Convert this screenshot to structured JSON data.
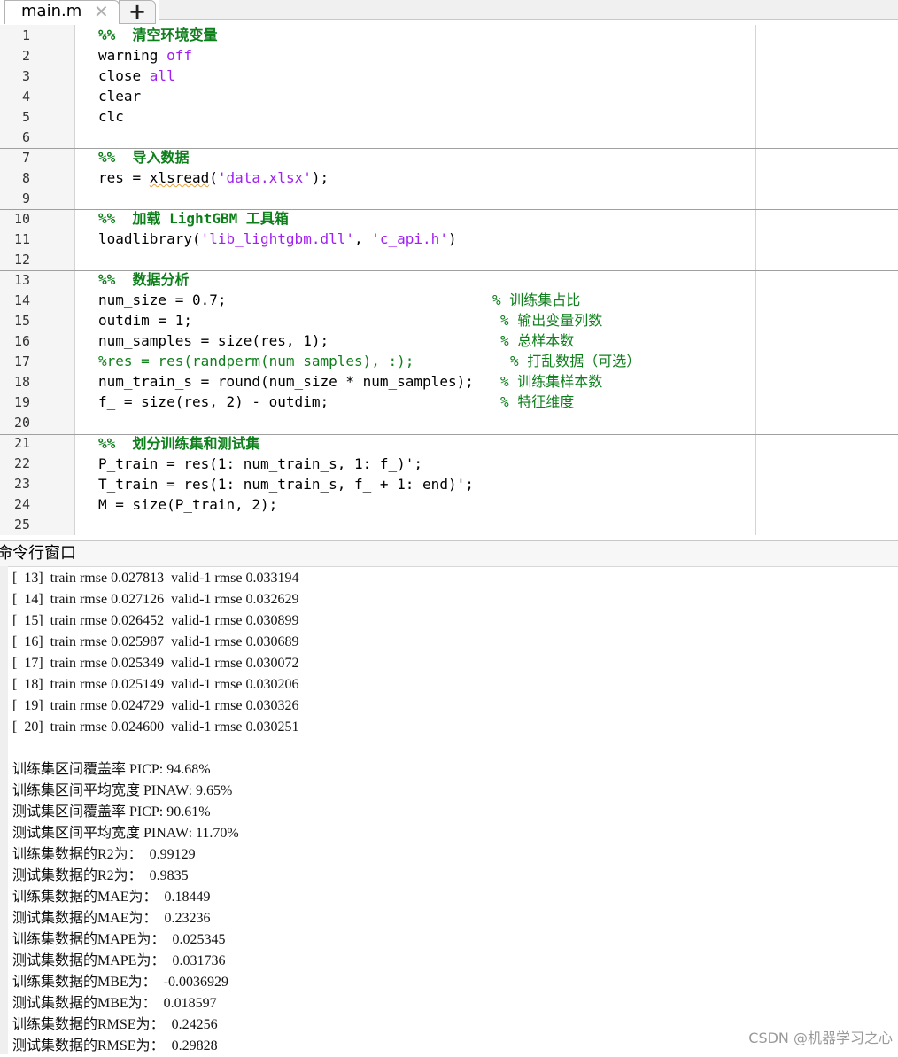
{
  "tab": {
    "filename": "main.m",
    "close_glyph": "✕",
    "add_glyph": "+"
  },
  "editor": {
    "lines": [
      {
        "n": "1"
      },
      {
        "n": "2"
      },
      {
        "n": "3"
      },
      {
        "n": "4"
      },
      {
        "n": "5"
      },
      {
        "n": "6"
      },
      {
        "n": "7"
      },
      {
        "n": "8"
      },
      {
        "n": "9"
      },
      {
        "n": "10"
      },
      {
        "n": "11"
      },
      {
        "n": "12"
      },
      {
        "n": "13"
      },
      {
        "n": "14"
      },
      {
        "n": "15"
      },
      {
        "n": "16"
      },
      {
        "n": "17"
      },
      {
        "n": "18"
      },
      {
        "n": "19"
      },
      {
        "n": "20"
      },
      {
        "n": "21"
      },
      {
        "n": "22"
      },
      {
        "n": "23"
      },
      {
        "n": "24"
      },
      {
        "n": "25"
      }
    ],
    "code": {
      "l1": "%%  清空环境变量",
      "l2a": "warning ",
      "l2b": "off",
      "l3a": "close ",
      "l3b": "all",
      "l4": "clear",
      "l5": "clc",
      "l7": "%%  导入数据",
      "l8a": "res = ",
      "l8b": "xlsread",
      "l8c": "(",
      "l8d": "'data.xlsx'",
      "l8e": ");",
      "l10": "%%  加载 LightGBM 工具箱",
      "l11a": "loadlibrary(",
      "l11b": "'lib_lightgbm.dll'",
      "l11c": ", ",
      "l11d": "'c_api.h'",
      "l11e": ")",
      "l13": "%%  数据分析",
      "l14": "num_size = 0.7;",
      "l14c": "% 训练集占比",
      "l15": "outdim = 1;",
      "l15c": "% 输出变量列数",
      "l16": "num_samples = size(res, 1);",
      "l16c": "% 总样本数",
      "l17": "%res = res(randperm(num_samples), :);",
      "l17c": "% 打乱数据（可选）",
      "l18": "num_train_s = round(num_size * num_samples);",
      "l18c": "% 训练集样本数",
      "l19": "f_ = size(res, 2) - outdim;",
      "l19c": "% 特征维度",
      "l21": "%%  划分训练集和测试集",
      "l22": "P_train = res(1: num_train_s, 1: f_)';",
      "l23": "T_train = res(1: num_train_s, f_ + 1: end)';",
      "l24": "M = size(P_train, 2);"
    }
  },
  "command_window": {
    "title": "命令行窗口",
    "iterations": [
      "[  13]  train rmse 0.027813  valid-1 rmse 0.033194",
      "[  14]  train rmse 0.027126  valid-1 rmse 0.032629",
      "[  15]  train rmse 0.026452  valid-1 rmse 0.030899",
      "[  16]  train rmse 0.025987  valid-1 rmse 0.030689",
      "[  17]  train rmse 0.025349  valid-1 rmse 0.030072",
      "[  18]  train rmse 0.025149  valid-1 rmse 0.030206",
      "[  19]  train rmse 0.024729  valid-1 rmse 0.030326",
      "[  20]  train rmse 0.024600  valid-1 rmse 0.030251"
    ],
    "metrics": [
      "训练集区间覆盖率 PICP: 94.68%",
      "训练集区间平均宽度 PINAW: 9.65%",
      "测试集区间覆盖率 PICP: 90.61%",
      "测试集区间平均宽度 PINAW: 11.70%",
      "训练集数据的R2为：  0.99129",
      "测试集数据的R2为：  0.9835",
      "训练集数据的MAE为：  0.18449",
      "测试集数据的MAE为：  0.23236",
      "训练集数据的MAPE为：  0.025345",
      "测试集数据的MAPE为：  0.031736",
      "训练集数据的MBE为：  -0.0036929",
      "测试集数据的MBE为：  0.018597",
      "训练集数据的RMSE为：  0.24256",
      "测试集数据的RMSE为：  0.29828"
    ]
  },
  "watermark": "CSDN @机器学习之心"
}
